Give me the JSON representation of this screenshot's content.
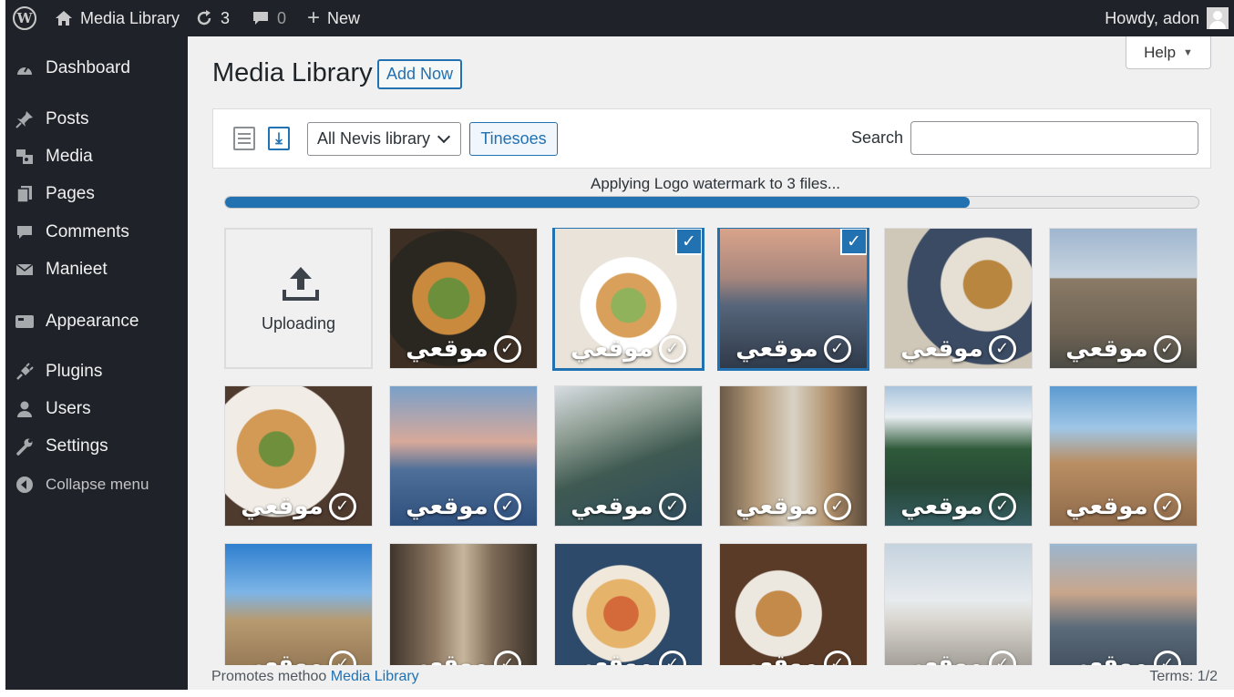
{
  "admin_bar": {
    "site_name": "Media Library",
    "updates_count": "3",
    "comments_count": "0",
    "new_label": "New",
    "greeting": "Howdy, adon"
  },
  "sidebar": {
    "items": [
      {
        "label": "Dashboard",
        "icon": "dashboard-icon"
      },
      {
        "label": "Posts",
        "icon": "pin-icon"
      },
      {
        "label": "Media",
        "icon": "media-icon"
      },
      {
        "label": "Pages",
        "icon": "page-icon"
      },
      {
        "label": "Comments",
        "icon": "comment-icon"
      },
      {
        "label": "Manieet",
        "icon": "mail-icon"
      },
      {
        "label": "Appearance",
        "icon": "appearance-icon"
      },
      {
        "label": "Plugins",
        "icon": "plugin-icon"
      },
      {
        "label": "Users",
        "icon": "user-icon"
      },
      {
        "label": "Settings",
        "icon": "wrench-icon"
      },
      {
        "label": "Collapse menu",
        "icon": "collapse-icon"
      }
    ]
  },
  "header": {
    "title": "Media Library",
    "add_new_label": "Add Now",
    "help_label": "Help"
  },
  "toolbar": {
    "filter_value": "All Nevis library",
    "filter_button": "Tinesoes",
    "search_label": "Search",
    "search_value": ""
  },
  "progress": {
    "text": "Applying Logo watermark to 3 files...",
    "fraction": 0.765
  },
  "upload_tile": {
    "label": "Uploading"
  },
  "watermark_text": "موقعي",
  "media_items": [
    {
      "kind": "food",
      "selected": false
    },
    {
      "kind": "food-bowl",
      "selected": true
    },
    {
      "kind": "sunset-lake",
      "selected": true
    },
    {
      "kind": "food-nuts",
      "selected": false
    },
    {
      "kind": "arch",
      "selected": false
    },
    {
      "kind": "tacos",
      "selected": false
    },
    {
      "kind": "mountains-dusk",
      "selected": false
    },
    {
      "kind": "fjord",
      "selected": false
    },
    {
      "kind": "old-street",
      "selected": false
    },
    {
      "kind": "forest-lake",
      "selected": false
    },
    {
      "kind": "city-view",
      "selected": false
    },
    {
      "kind": "church",
      "selected": false
    },
    {
      "kind": "alley",
      "selected": false
    },
    {
      "kind": "noodle-bowl",
      "selected": false
    },
    {
      "kind": "plates",
      "selected": false
    },
    {
      "kind": "capitol",
      "selected": false
    },
    {
      "kind": "valley",
      "selected": false
    }
  ],
  "footer": {
    "left_prefix": "Promotes methoo",
    "left_link": "Media Library",
    "right_text": "Terms: 1/2"
  },
  "colors": {
    "accent": "#2271b1",
    "sidebar_bg": "#1f2329",
    "content_bg": "#f0f0f1"
  }
}
